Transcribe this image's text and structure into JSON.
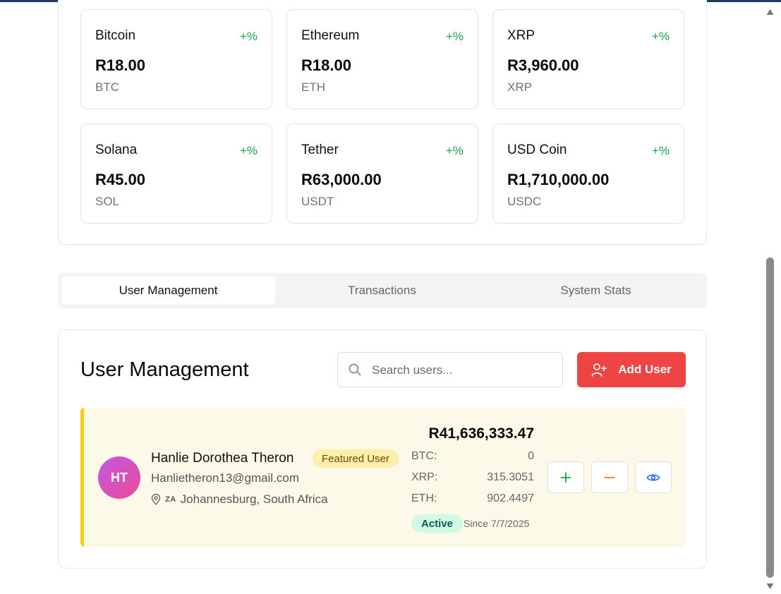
{
  "cryptos": [
    {
      "name": "Bitcoin",
      "change": "+%",
      "price": "R18.00",
      "symbol": "BTC"
    },
    {
      "name": "Ethereum",
      "change": "+%",
      "price": "R18.00",
      "symbol": "ETH"
    },
    {
      "name": "XRP",
      "change": "+%",
      "price": "R3,960.00",
      "symbol": "XRP"
    },
    {
      "name": "Solana",
      "change": "+%",
      "price": "R45.00",
      "symbol": "SOL"
    },
    {
      "name": "Tether",
      "change": "+%",
      "price": "R63,000.00",
      "symbol": "USDT"
    },
    {
      "name": "USD Coin",
      "change": "+%",
      "price": "R1,710,000.00",
      "symbol": "USDC"
    }
  ],
  "tabs": [
    {
      "label": "User Management",
      "active": true
    },
    {
      "label": "Transactions",
      "active": false
    },
    {
      "label": "System Stats",
      "active": false
    }
  ],
  "user_management": {
    "title": "User Management",
    "search_placeholder": "Search users...",
    "search_value": "",
    "add_user_label": "Add User"
  },
  "users": [
    {
      "initials": "HT",
      "name": "Hanlie Dorothea Theron",
      "badge": "Featured User",
      "email": "Hanlietheron13@gmail.com",
      "country_code": "ZA",
      "location": "Johannesburg, South Africa",
      "total_balance": "R41,636,333.47",
      "balances": [
        {
          "label": "BTC:",
          "value": "0"
        },
        {
          "label": "XRP:",
          "value": "315.3051"
        },
        {
          "label": "ETH:",
          "value": "902.4497"
        }
      ],
      "status": "Active",
      "since": "Since 7/7/2025"
    }
  ],
  "icons": {
    "search": "search-icon",
    "add_user": "user-plus-icon",
    "location": "map-pin-icon",
    "add": "plus-icon",
    "subtract": "minus-icon",
    "view": "eye-icon"
  },
  "colors": {
    "positive": "#16a34a",
    "add_button": "#ef4444",
    "featured_accent": "#facc15",
    "row_background": "#fdf9e8",
    "active_badge": "#d1fae5",
    "view_icon": "#2563eb",
    "minus_icon": "#f97316"
  }
}
